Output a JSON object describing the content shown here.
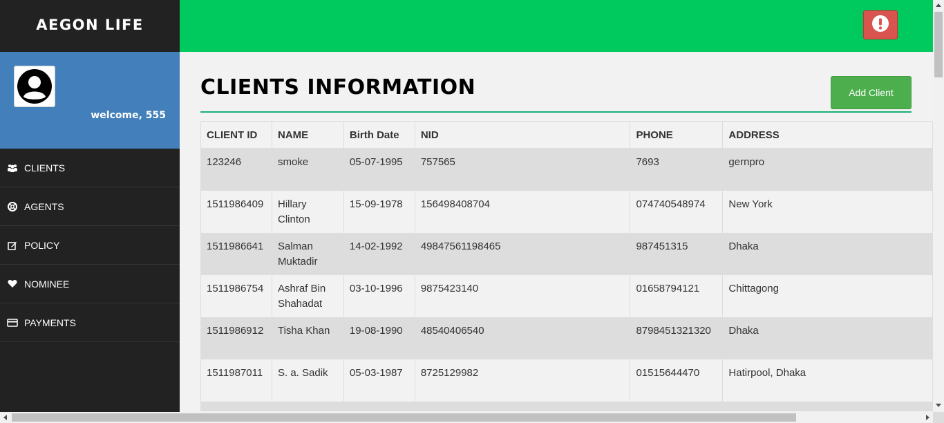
{
  "brand": {
    "title": "AEGON LIFE"
  },
  "profile": {
    "welcome": "welcome, 555",
    "avatar_icon": "user-avatar-icon"
  },
  "nav": {
    "items": [
      {
        "label": "CLIENTS",
        "icon": "users-icon"
      },
      {
        "label": "AGENTS",
        "icon": "life-ring-icon"
      },
      {
        "label": "POLICY",
        "icon": "edit-icon"
      },
      {
        "label": "NOMINEE",
        "icon": "heart-icon"
      },
      {
        "label": "PAYMENTS",
        "icon": "credit-card-icon"
      }
    ]
  },
  "topbar": {
    "alert_icon": "exclamation-circle-icon"
  },
  "main": {
    "title": "CLIENTS INFORMATION",
    "add_button": "Add Client",
    "table": {
      "headers": [
        "CLIENT ID",
        "NAME",
        "Birth Date",
        "NID",
        "PHONE",
        "ADDRESS"
      ],
      "rows": [
        [
          "123246",
          "smoke",
          "05-07-1995",
          "757565",
          "7693",
          "gernpro"
        ],
        [
          "1511986409",
          "Hillary Clinton",
          "15-09-1978",
          "156498408704",
          "074740548974",
          "New York"
        ],
        [
          "1511986641",
          "Salman Muktadir",
          "14-02-1992",
          "49847561198465",
          "987451315",
          "Dhaka"
        ],
        [
          "1511986754",
          "Ashraf Bin Shahadat",
          "03-10-1996",
          "9875423140",
          "01658794121",
          "Chittagong"
        ],
        [
          "1511986912",
          "Tisha Khan",
          "19-08-1990",
          "48540406540",
          "8798451321320",
          "Dhaka"
        ],
        [
          "1511987011",
          "S. a. Sadik",
          "05-03-1987",
          "8725129982",
          "01515644470",
          "Hatirpool, Dhaka"
        ]
      ]
    }
  },
  "colors": {
    "sidebar": "#222222",
    "profile": "#4380bb",
    "topbar": "#00c95e",
    "alert": "#d9534f",
    "add_button": "#4cae4c",
    "title_rule": "#1aae75"
  }
}
